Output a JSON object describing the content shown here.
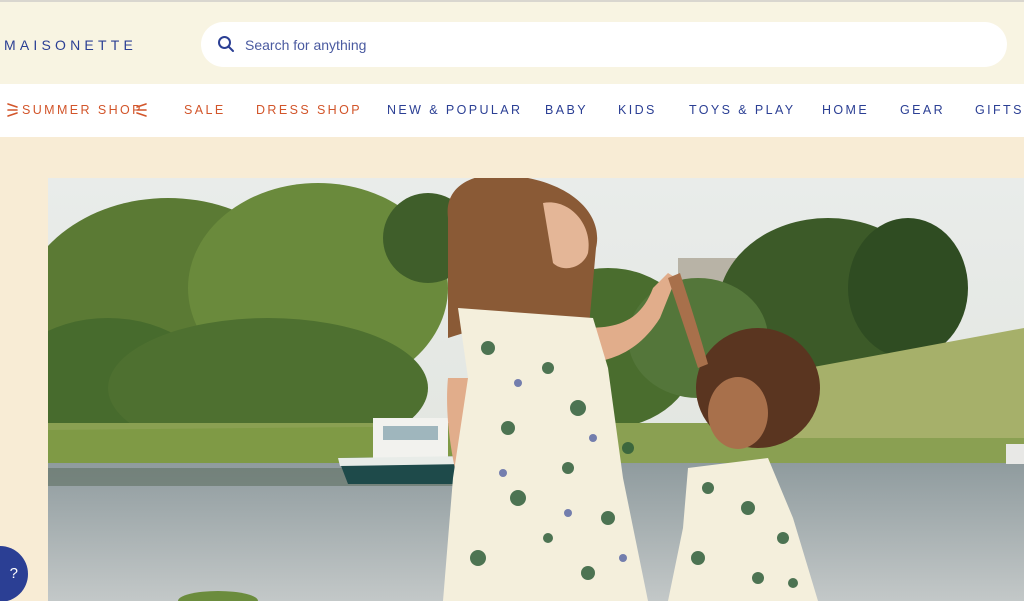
{
  "brand": {
    "logo_text": "MAISONETTE"
  },
  "search": {
    "placeholder": "Search for anything"
  },
  "nav": {
    "items": [
      {
        "label": "SUMMER SHOP"
      },
      {
        "label": "SALE"
      },
      {
        "label": "DRESS SHOP"
      },
      {
        "label": "NEW & POPULAR"
      },
      {
        "label": "BABY"
      },
      {
        "label": "KIDS"
      },
      {
        "label": "TOYS & PLAY"
      },
      {
        "label": "HOME"
      },
      {
        "label": "GEAR"
      },
      {
        "label": "GIFTS"
      }
    ]
  },
  "help": {
    "label": "?"
  },
  "colors": {
    "brand_blue": "#2b3f94",
    "accent_orange": "#d2552a",
    "page_bg": "#f8f2e1",
    "band_bg": "#f8ecd5"
  },
  "icons": [
    "search-icon",
    "sun-icon",
    "help-icon"
  ],
  "hero": {
    "image": "mother-and-daughter-in-floral-dresses-by-waterfront"
  }
}
